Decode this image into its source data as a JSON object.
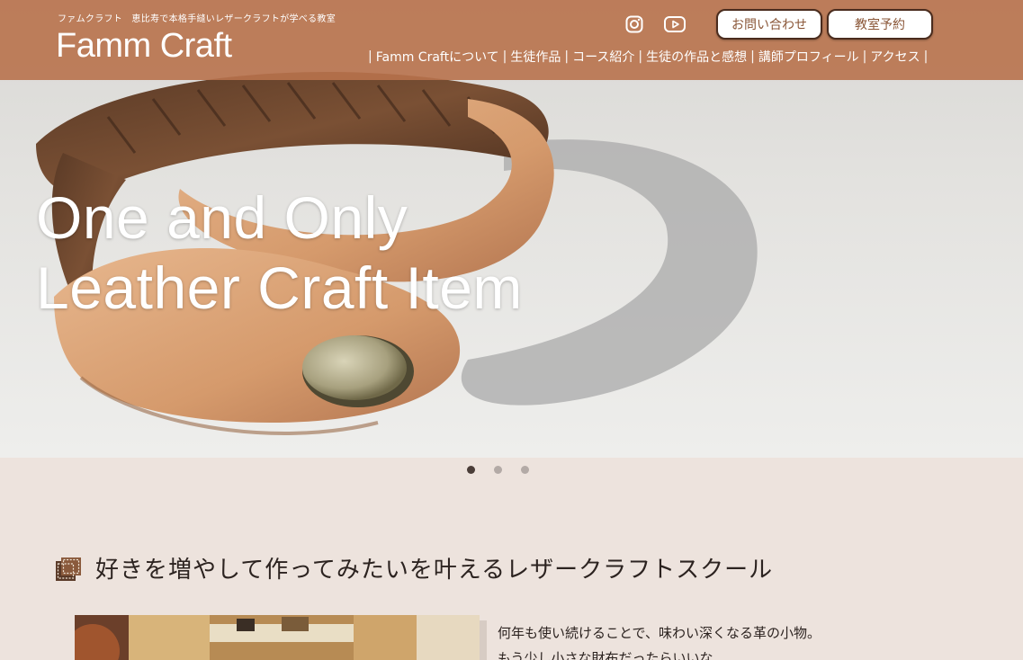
{
  "header": {
    "tagline": "ファムクラフト　恵比寿で本格手縫いレザークラフトが学べる教室",
    "logo": "Famm Craft",
    "contact_button": "お問い合わせ",
    "reserve_button": "教室予約",
    "social_icons": [
      "instagram-icon",
      "youtube-icon"
    ]
  },
  "nav": {
    "items": [
      "Famm Craftについて",
      "生徒作品",
      "コース紹介",
      "生徒の作品と感想",
      "講師プロフィール",
      "アクセス"
    ]
  },
  "hero": {
    "line1": "One and Only",
    "line2": "Leather Craft Item",
    "slides": 3,
    "active_slide": 1
  },
  "section": {
    "title": "好きを増やして作ってみたいを叶えるレザークラフトスクール",
    "paragraph_line1": "何年も使い続けることで、味わい深くなる革の小物。",
    "paragraph_line2": "もう少し小さな財布だったらいいな"
  },
  "colors": {
    "header_bg": "#b8724c",
    "page_bg": "#ede3dd",
    "button_text": "#8a5637"
  }
}
